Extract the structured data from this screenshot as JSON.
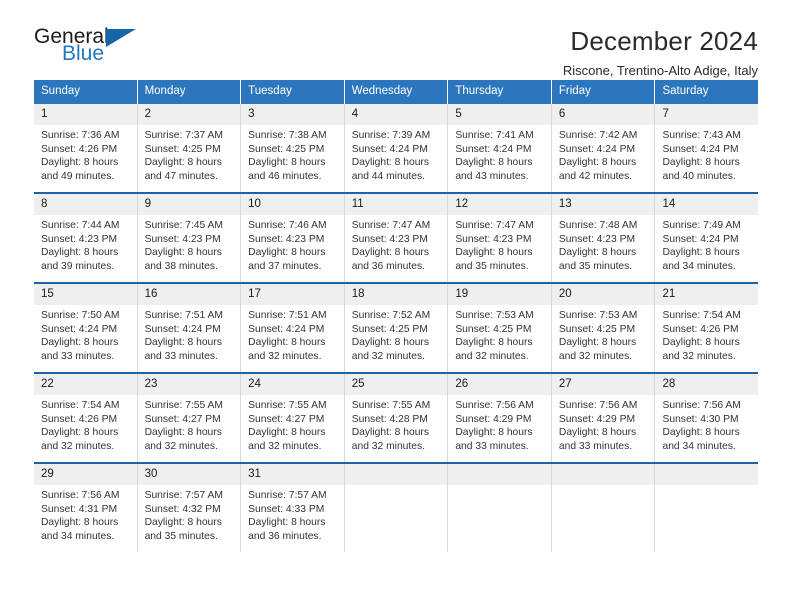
{
  "logo": {
    "text_top": "General",
    "text_bottom": "Blue",
    "icon": "blue-triangle"
  },
  "header": {
    "title": "December 2024",
    "subtitle": "Riscone, Trentino-Alto Adige, Italy"
  },
  "colors": {
    "header_blue": "#2c76bd",
    "row_divider_blue": "#1c64a8",
    "daynum_band": "#efefef",
    "logo_blue": "#2277bf"
  },
  "weekdays": [
    "Sunday",
    "Monday",
    "Tuesday",
    "Wednesday",
    "Thursday",
    "Friday",
    "Saturday"
  ],
  "weeks": [
    [
      {
        "day": "1",
        "sunrise": "Sunrise: 7:36 AM",
        "sunset": "Sunset: 4:26 PM",
        "daylight_1": "Daylight: 8 hours",
        "daylight_2": "and 49 minutes."
      },
      {
        "day": "2",
        "sunrise": "Sunrise: 7:37 AM",
        "sunset": "Sunset: 4:25 PM",
        "daylight_1": "Daylight: 8 hours",
        "daylight_2": "and 47 minutes."
      },
      {
        "day": "3",
        "sunrise": "Sunrise: 7:38 AM",
        "sunset": "Sunset: 4:25 PM",
        "daylight_1": "Daylight: 8 hours",
        "daylight_2": "and 46 minutes."
      },
      {
        "day": "4",
        "sunrise": "Sunrise: 7:39 AM",
        "sunset": "Sunset: 4:24 PM",
        "daylight_1": "Daylight: 8 hours",
        "daylight_2": "and 44 minutes."
      },
      {
        "day": "5",
        "sunrise": "Sunrise: 7:41 AM",
        "sunset": "Sunset: 4:24 PM",
        "daylight_1": "Daylight: 8 hours",
        "daylight_2": "and 43 minutes."
      },
      {
        "day": "6",
        "sunrise": "Sunrise: 7:42 AM",
        "sunset": "Sunset: 4:24 PM",
        "daylight_1": "Daylight: 8 hours",
        "daylight_2": "and 42 minutes."
      },
      {
        "day": "7",
        "sunrise": "Sunrise: 7:43 AM",
        "sunset": "Sunset: 4:24 PM",
        "daylight_1": "Daylight: 8 hours",
        "daylight_2": "and 40 minutes."
      }
    ],
    [
      {
        "day": "8",
        "sunrise": "Sunrise: 7:44 AM",
        "sunset": "Sunset: 4:23 PM",
        "daylight_1": "Daylight: 8 hours",
        "daylight_2": "and 39 minutes."
      },
      {
        "day": "9",
        "sunrise": "Sunrise: 7:45 AM",
        "sunset": "Sunset: 4:23 PM",
        "daylight_1": "Daylight: 8 hours",
        "daylight_2": "and 38 minutes."
      },
      {
        "day": "10",
        "sunrise": "Sunrise: 7:46 AM",
        "sunset": "Sunset: 4:23 PM",
        "daylight_1": "Daylight: 8 hours",
        "daylight_2": "and 37 minutes."
      },
      {
        "day": "11",
        "sunrise": "Sunrise: 7:47 AM",
        "sunset": "Sunset: 4:23 PM",
        "daylight_1": "Daylight: 8 hours",
        "daylight_2": "and 36 minutes."
      },
      {
        "day": "12",
        "sunrise": "Sunrise: 7:47 AM",
        "sunset": "Sunset: 4:23 PM",
        "daylight_1": "Daylight: 8 hours",
        "daylight_2": "and 35 minutes."
      },
      {
        "day": "13",
        "sunrise": "Sunrise: 7:48 AM",
        "sunset": "Sunset: 4:23 PM",
        "daylight_1": "Daylight: 8 hours",
        "daylight_2": "and 35 minutes."
      },
      {
        "day": "14",
        "sunrise": "Sunrise: 7:49 AM",
        "sunset": "Sunset: 4:24 PM",
        "daylight_1": "Daylight: 8 hours",
        "daylight_2": "and 34 minutes."
      }
    ],
    [
      {
        "day": "15",
        "sunrise": "Sunrise: 7:50 AM",
        "sunset": "Sunset: 4:24 PM",
        "daylight_1": "Daylight: 8 hours",
        "daylight_2": "and 33 minutes."
      },
      {
        "day": "16",
        "sunrise": "Sunrise: 7:51 AM",
        "sunset": "Sunset: 4:24 PM",
        "daylight_1": "Daylight: 8 hours",
        "daylight_2": "and 33 minutes."
      },
      {
        "day": "17",
        "sunrise": "Sunrise: 7:51 AM",
        "sunset": "Sunset: 4:24 PM",
        "daylight_1": "Daylight: 8 hours",
        "daylight_2": "and 32 minutes."
      },
      {
        "day": "18",
        "sunrise": "Sunrise: 7:52 AM",
        "sunset": "Sunset: 4:25 PM",
        "daylight_1": "Daylight: 8 hours",
        "daylight_2": "and 32 minutes."
      },
      {
        "day": "19",
        "sunrise": "Sunrise: 7:53 AM",
        "sunset": "Sunset: 4:25 PM",
        "daylight_1": "Daylight: 8 hours",
        "daylight_2": "and 32 minutes."
      },
      {
        "day": "20",
        "sunrise": "Sunrise: 7:53 AM",
        "sunset": "Sunset: 4:25 PM",
        "daylight_1": "Daylight: 8 hours",
        "daylight_2": "and 32 minutes."
      },
      {
        "day": "21",
        "sunrise": "Sunrise: 7:54 AM",
        "sunset": "Sunset: 4:26 PM",
        "daylight_1": "Daylight: 8 hours",
        "daylight_2": "and 32 minutes."
      }
    ],
    [
      {
        "day": "22",
        "sunrise": "Sunrise: 7:54 AM",
        "sunset": "Sunset: 4:26 PM",
        "daylight_1": "Daylight: 8 hours",
        "daylight_2": "and 32 minutes."
      },
      {
        "day": "23",
        "sunrise": "Sunrise: 7:55 AM",
        "sunset": "Sunset: 4:27 PM",
        "daylight_1": "Daylight: 8 hours",
        "daylight_2": "and 32 minutes."
      },
      {
        "day": "24",
        "sunrise": "Sunrise: 7:55 AM",
        "sunset": "Sunset: 4:27 PM",
        "daylight_1": "Daylight: 8 hours",
        "daylight_2": "and 32 minutes."
      },
      {
        "day": "25",
        "sunrise": "Sunrise: 7:55 AM",
        "sunset": "Sunset: 4:28 PM",
        "daylight_1": "Daylight: 8 hours",
        "daylight_2": "and 32 minutes."
      },
      {
        "day": "26",
        "sunrise": "Sunrise: 7:56 AM",
        "sunset": "Sunset: 4:29 PM",
        "daylight_1": "Daylight: 8 hours",
        "daylight_2": "and 33 minutes."
      },
      {
        "day": "27",
        "sunrise": "Sunrise: 7:56 AM",
        "sunset": "Sunset: 4:29 PM",
        "daylight_1": "Daylight: 8 hours",
        "daylight_2": "and 33 minutes."
      },
      {
        "day": "28",
        "sunrise": "Sunrise: 7:56 AM",
        "sunset": "Sunset: 4:30 PM",
        "daylight_1": "Daylight: 8 hours",
        "daylight_2": "and 34 minutes."
      }
    ],
    [
      {
        "day": "29",
        "sunrise": "Sunrise: 7:56 AM",
        "sunset": "Sunset: 4:31 PM",
        "daylight_1": "Daylight: 8 hours",
        "daylight_2": "and 34 minutes."
      },
      {
        "day": "30",
        "sunrise": "Sunrise: 7:57 AM",
        "sunset": "Sunset: 4:32 PM",
        "daylight_1": "Daylight: 8 hours",
        "daylight_2": "and 35 minutes."
      },
      {
        "day": "31",
        "sunrise": "Sunrise: 7:57 AM",
        "sunset": "Sunset: 4:33 PM",
        "daylight_1": "Daylight: 8 hours",
        "daylight_2": "and 36 minutes."
      },
      {
        "day": "",
        "sunrise": "",
        "sunset": "",
        "daylight_1": "",
        "daylight_2": ""
      },
      {
        "day": "",
        "sunrise": "",
        "sunset": "",
        "daylight_1": "",
        "daylight_2": ""
      },
      {
        "day": "",
        "sunrise": "",
        "sunset": "",
        "daylight_1": "",
        "daylight_2": ""
      },
      {
        "day": "",
        "sunrise": "",
        "sunset": "",
        "daylight_1": "",
        "daylight_2": ""
      }
    ]
  ]
}
